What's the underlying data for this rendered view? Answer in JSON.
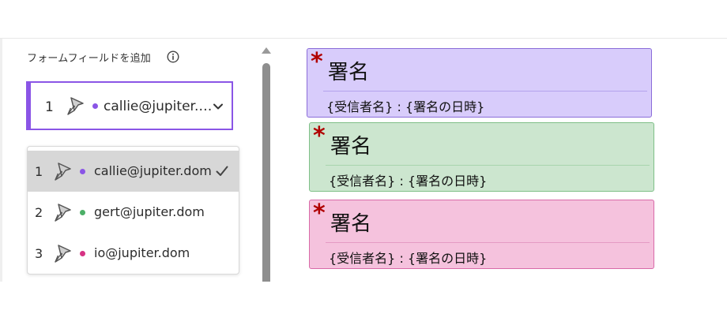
{
  "panel": {
    "title": "フォームフィールドを追加"
  },
  "selected_recipient": {
    "number": "1",
    "email": "callie@jupiter.…",
    "color": "#8a55e6"
  },
  "dropdown": {
    "items": [
      {
        "number": "1",
        "email": "callie@jupiter.dom",
        "color": "#8a55e6",
        "selected": true
      },
      {
        "number": "2",
        "email": "gert@jupiter.dom",
        "color": "#4caf67",
        "selected": false
      },
      {
        "number": "3",
        "email": "io@jupiter.dom",
        "color": "#d63384",
        "selected": false
      }
    ]
  },
  "signature_fields": [
    {
      "required_mark": "*",
      "label": "署名",
      "sub": "{受信者名} : {署名の日時}",
      "fill": "#d8ccfb",
      "border": "#8b6dd9"
    },
    {
      "required_mark": "*",
      "label": "署名",
      "sub": "{受信者名} : {署名の日時}",
      "fill": "#cce6cf",
      "border": "#7fbf88"
    },
    {
      "required_mark": "*",
      "label": "署名",
      "sub": "{受信者名} : {署名の日時}",
      "fill": "#f5c2dd",
      "border": "#d86aa8"
    }
  ]
}
